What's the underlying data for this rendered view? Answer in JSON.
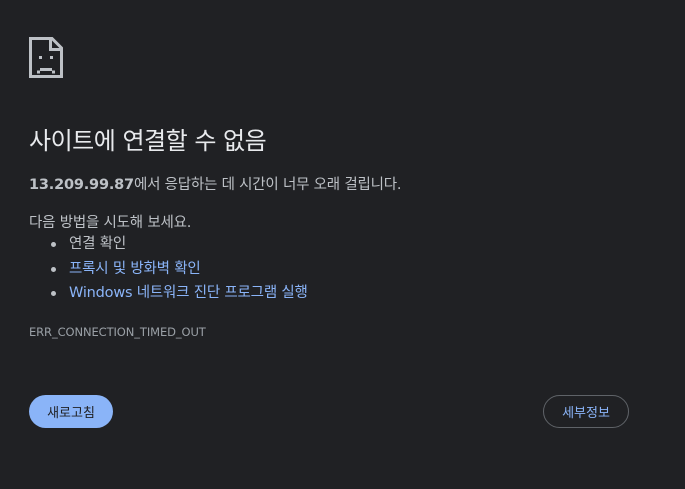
{
  "error_page": {
    "icon": "sad-page-icon",
    "title": "사이트에 연결할 수 없음",
    "summary": {
      "host": "13.209.99.87",
      "message": "에서 응답하는 데 시간이 너무 오래 걸립니다."
    },
    "suggestions": {
      "heading": "다음 방법을 시도해 보세요.",
      "items": [
        {
          "label": "연결 확인",
          "is_link": false
        },
        {
          "label": "프록시 및 방화벽 확인",
          "is_link": true
        },
        {
          "label": "Windows 네트워크 진단 프로그램 실행",
          "is_link": true
        }
      ]
    },
    "error_code": "ERR_CONNECTION_TIMED_OUT",
    "buttons": {
      "reload_label": "새로고침",
      "details_label": "세부정보"
    }
  },
  "colors": {
    "background": "#202124",
    "title": "#e8eaed",
    "text": "#bdc1c6",
    "link": "#8ab4f8",
    "primary_button": "#8ab4f8"
  }
}
